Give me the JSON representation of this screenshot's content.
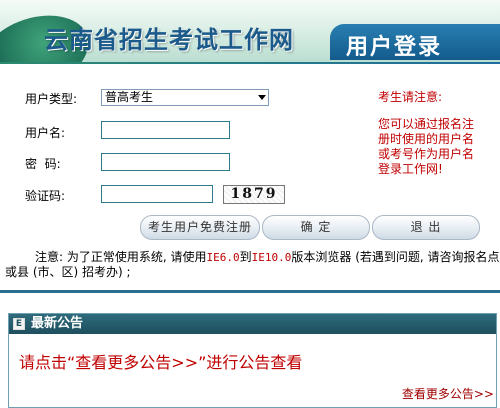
{
  "header": {
    "site_title": "云南省招生考试工作网",
    "login_title": "用户登录"
  },
  "form": {
    "user_type_label": "用户类型:",
    "user_type_value": "普高考生",
    "username_label": "用户名:",
    "password_label": "密  码:",
    "captcha_label": "验证码:",
    "captcha_value": "1879"
  },
  "side_notice": {
    "title": "考生请注意:",
    "body": "您可以通过报名注册时使用的用户名或考号作为用户名登录工作网!"
  },
  "buttons": {
    "register": "考生用户免费注册",
    "confirm": "确 定",
    "exit": "退 出"
  },
  "browser_note": {
    "prefix": "注意: 为了正常使用系统, 请使用",
    "ie_from": "IE6.0",
    "to_word": "到",
    "ie_to": "IE10.0",
    "suffix": "版本浏览器 (若遇到问题, 请咨询报名点或县 (市、区) 招考办) ;"
  },
  "announcements": {
    "title": "最新公告",
    "message": "请点击“查看更多公告>>”进行公告查看",
    "more_link": "查看更多公告>>"
  },
  "colors": {
    "accent_red": "#c00000",
    "header_blue": "#135b8c",
    "panel_teal": "#1e4f5e"
  }
}
